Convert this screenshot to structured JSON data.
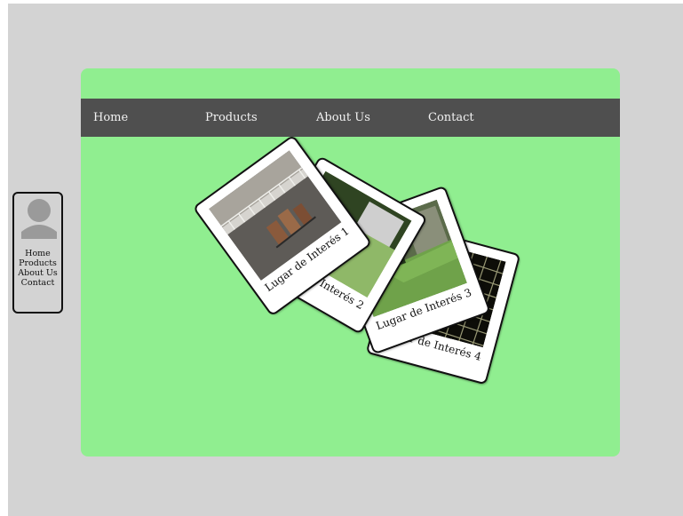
{
  "nav": {
    "home": "Home",
    "products": "Products",
    "about": "About Us",
    "contact": "Contact"
  },
  "sidebar": {
    "links": [
      "Home",
      "Products",
      "About Us",
      "Contact"
    ]
  },
  "gallery": {
    "cards": [
      {
        "caption": "Lugar de Interés 1"
      },
      {
        "caption": "Lugar de Interés 2"
      },
      {
        "caption": "Lugar de Interés 3"
      },
      {
        "caption": "Lugar de Interés 4"
      }
    ]
  },
  "colors": {
    "background": "#d3d3d3",
    "panel": "#90ee90",
    "navbar": "#4f4f4f",
    "nav_text": "#f2f2f2",
    "card": "#ffffff"
  }
}
